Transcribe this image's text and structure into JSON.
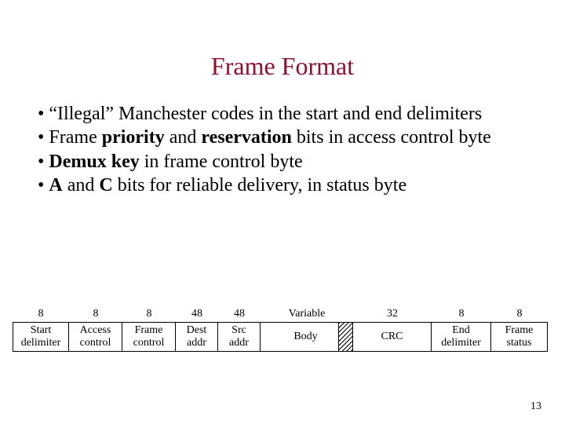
{
  "title": "Frame Format",
  "bullets": [
    {
      "pre": "“Illegal” Manchester codes in the start and end delimiters"
    },
    {
      "pre": "Frame ",
      "b1": "priority",
      "mid": " and ",
      "b2": "reservation",
      "post": " bits in access control byte"
    },
    {
      "b1": "Demux key",
      "post": " in frame control byte"
    },
    {
      "b1": "A",
      "mid": " and ",
      "b2": "C",
      "post": " bits for reliable delivery, in status byte"
    }
  ],
  "frame": {
    "sizes": [
      "8",
      "8",
      "8",
      "48",
      "48",
      "Variable",
      "32",
      "8",
      "8"
    ],
    "labels": [
      "Start delimiter",
      "Access control",
      "Frame control",
      "Dest addr",
      "Src addr",
      "Body",
      "CRC",
      "End delimiter",
      "Frame status"
    ]
  },
  "page_number": "13"
}
